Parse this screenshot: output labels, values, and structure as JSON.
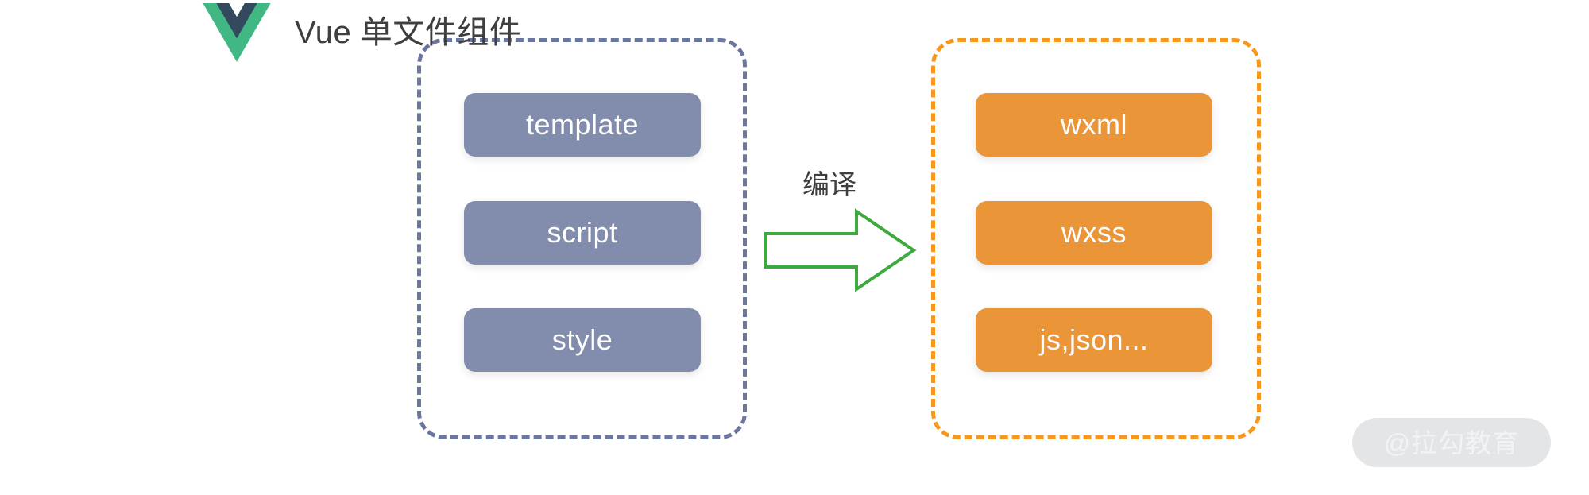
{
  "header": {
    "logo_icon": "vue-logo-icon",
    "title": "Vue 单文件组件"
  },
  "diagram": {
    "type": "flow",
    "left_group": {
      "name": "vue-single-file-component",
      "border_color": "#6c779e",
      "block_color": "#828cac",
      "blocks": [
        {
          "label": "template"
        },
        {
          "label": "script"
        },
        {
          "label": "style"
        }
      ]
    },
    "transition": {
      "label": "编译",
      "arrow_icon": "right-block-arrow-icon",
      "arrow_color": "#3caa3c",
      "direction": "left-to-right"
    },
    "right_group": {
      "name": "miniprogram-output",
      "border_color": "#f7981d",
      "block_color": "#e99538",
      "blocks": [
        {
          "label": "wxml"
        },
        {
          "label": "wxss"
        },
        {
          "label": "js,json..."
        }
      ]
    }
  },
  "watermark": {
    "text": "@拉勾教育"
  }
}
